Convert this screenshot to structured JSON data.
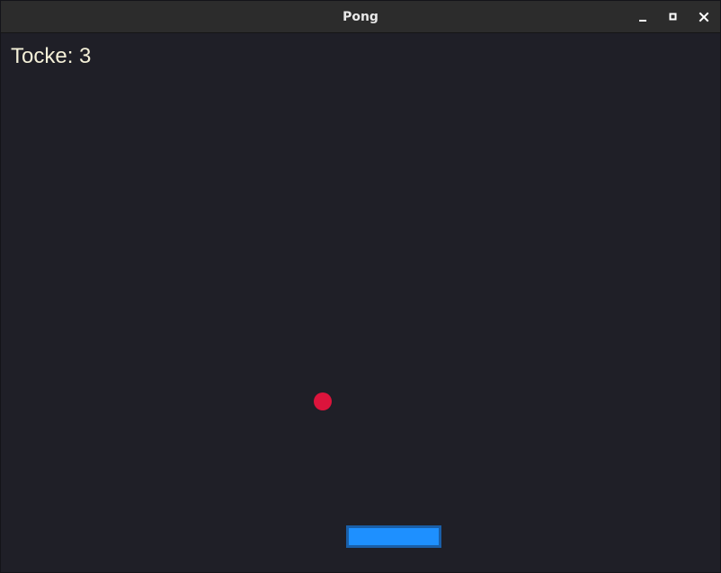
{
  "window": {
    "title": "Pong"
  },
  "controls": {
    "minimize_icon": "minimize-icon",
    "maximize_icon": "maximize-icon",
    "close_icon": "close-icon"
  },
  "game": {
    "score_text": "Tocke: 3",
    "background_color": "#1f1f27",
    "ball_color": "#dc143c",
    "paddle_color": "#1e90ff",
    "paddle_border_color": "#1a5fa8",
    "score_color": "#f4f0d8"
  }
}
